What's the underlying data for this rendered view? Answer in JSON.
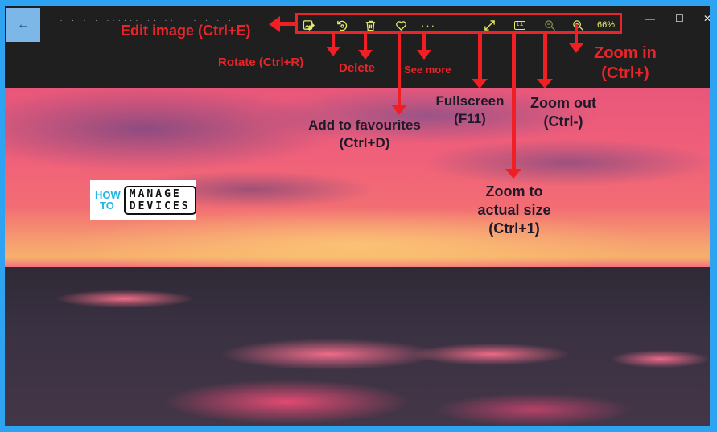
{
  "window": {
    "back_label": "←",
    "filename": "· ·  · ·  ······ ·· ·· ·  · ·   · ·",
    "controls": {
      "minimize": "—",
      "maximize": "☐",
      "close": "✕"
    }
  },
  "toolbar": {
    "items": [
      {
        "id": "edit",
        "icon": "edit-image-icon",
        "tooltip": "Edit image (Ctrl+E)"
      },
      {
        "id": "rotate",
        "icon": "rotate-icon",
        "tooltip": "Rotate (Ctrl+R)"
      },
      {
        "id": "delete",
        "icon": "trash-icon",
        "tooltip": "Delete"
      },
      {
        "id": "favourite",
        "icon": "heart-icon",
        "tooltip": "Add to favourites (Ctrl+D)"
      },
      {
        "id": "more",
        "icon": "more-icon",
        "label": "···",
        "tooltip": "See more"
      },
      {
        "id": "fullscreen",
        "icon": "fullscreen-icon",
        "tooltip": "Fullscreen (F11)"
      },
      {
        "id": "actual-size",
        "icon": "actual-size-icon",
        "label": "1:1",
        "tooltip": "Zoom to actual size (Ctrl+1)"
      },
      {
        "id": "zoom-out",
        "icon": "zoom-out-icon",
        "tooltip": "Zoom out (Ctrl-)"
      },
      {
        "id": "zoom-in",
        "icon": "zoom-in-icon",
        "tooltip": "Zoom in (Ctrl+)"
      }
    ],
    "zoom_level": "66%"
  },
  "annotations": {
    "edit": "Edit image (Ctrl+E)",
    "rotate": "Rotate (Ctrl+R)",
    "delete": "Delete",
    "see_more": "See more",
    "favourites_line1": "Add to favourites",
    "favourites_line2": "(Ctrl+D)",
    "fullscreen_line1": "Fullscreen",
    "fullscreen_line2": "(F11)",
    "zoom_out_line1": "Zoom out",
    "zoom_out_line2": "(Ctrl-)",
    "zoom_in_line1": "Zoom in",
    "zoom_in_line2": "(Ctrl+)",
    "actual_line1": "Zoom to",
    "actual_line2": "actual size",
    "actual_line3": "(Ctrl+1)"
  },
  "logo": {
    "how": "HOW",
    "to": "TO",
    "manage": "MANAGE",
    "devices": "DEVICES"
  },
  "colors": {
    "annotation_red": "#e8252a",
    "toolbar_icon": "#e7e96a",
    "frame_blue": "#2ea3f2"
  }
}
